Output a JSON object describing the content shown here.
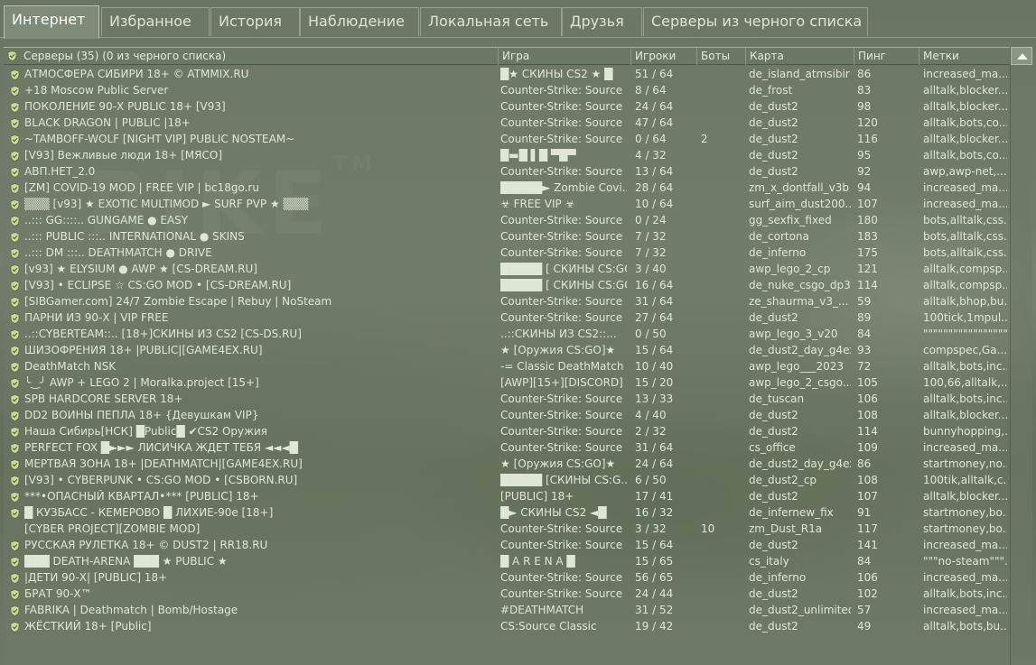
{
  "tabs": [
    {
      "label": "Интернет",
      "active": true
    },
    {
      "label": "Избранное"
    },
    {
      "label": "История"
    },
    {
      "label": "Наблюдение"
    },
    {
      "label": "Локальная сеть"
    },
    {
      "label": "Друзья"
    },
    {
      "label": "Серверы из черного списка"
    }
  ],
  "columns": {
    "servers": "Серверы (35) (0 из черного списка)",
    "game": "Игра",
    "players": "Игроки",
    "bots": "Боты",
    "map": "Карта",
    "ping": "Пинг",
    "tags": "Метки"
  },
  "servers": [
    {
      "name": "АТМОСФЕРА СИБИРИ 18+ © ATMMIX.RU",
      "game": "█★ СКИНЫ CS2 ★ █",
      "players": "51 / 64",
      "bots": "",
      "map": "de_island_atmsibir",
      "ping": "86",
      "tags": "increased_ma..."
    },
    {
      "name": "+18 Moscow Public Server",
      "game": "Counter-Strike: Source",
      "players": "8 / 64",
      "bots": "",
      "map": "de_frost",
      "ping": "83",
      "tags": "alltalk,blocker..."
    },
    {
      "name": "ПОКОЛЕНИЕ 90-Х PUBLIC 18+ [V93]",
      "game": "Counter-Strike: Source",
      "players": "24 / 64",
      "bots": "",
      "map": "de_dust2",
      "ping": "98",
      "tags": "alltalk,blocker..."
    },
    {
      "name": "BLACK DRAGON | PUBLIC |18+",
      "game": "Counter-Strike: Source",
      "players": "47 / 64",
      "bots": "",
      "map": "de_dust2",
      "ping": "120",
      "tags": "alltalk,bots,co..."
    },
    {
      "name": "~TAMBOFF-WOLF [NIGHT VIP] PUBLIC NOSTEAM~",
      "game": "Counter-Strike: Source",
      "players": "0 / 64",
      "bots": "2",
      "map": "de_dust2",
      "ping": "116",
      "tags": "alltalk,blocker..."
    },
    {
      "name": "[V93] Вежливые люди 18+ [МЯСО]",
      "game": "█▬█ ▌█ ▀█▀",
      "players": "4 / 32",
      "bots": "",
      "map": "de_dust2",
      "ping": "95",
      "tags": "alltalk,bots,co..."
    },
    {
      "name": "АВП.НЕТ_2.0",
      "game": "Counter-Strike: Source",
      "players": "13 / 64",
      "bots": "",
      "map": "de_dust2",
      "ping": "92",
      "tags": "awp,awp-net,..."
    },
    {
      "name": "[ZM] COVID-19 MOD | FREE VIP | bc18go.ru",
      "game": "█████► Zombie Covi...",
      "players": "28 / 64",
      "bots": "",
      "map": "zm_x_dontfall_v3b",
      "ping": "94",
      "tags": "increased_ma..."
    },
    {
      "name": "▒▒▒ [v93] ★ EXOTIC MULTIMOD ► SURF PVP ★ ▒▒▒",
      "game": "☣ FREE VIP ☣",
      "players": "10 / 64",
      "bots": "",
      "map": "surf_aim_dust200...",
      "ping": "107",
      "tags": "increased_ma..."
    },
    {
      "name": "..::: GG::::.. GUNGAME ● EASY",
      "game": "Counter-Strike: Source",
      "players": "0 / 24",
      "bots": "",
      "map": "gg_sexfix_fixed",
      "ping": "180",
      "tags": "bots,alltalk,css..."
    },
    {
      "name": "..::: PUBLIC :::.. INTERNATIONAL ● SKINS",
      "game": "Counter-Strike: Source",
      "players": "7 / 32",
      "bots": "",
      "map": "de_cortona",
      "ping": "183",
      "tags": "bots,alltalk,css..."
    },
    {
      "name": "..::: DM :::.. DEATHMATCH ● DRIVE",
      "game": "Counter-Strike: Source",
      "players": "7 / 32",
      "bots": "",
      "map": "de_inferno",
      "ping": "175",
      "tags": "bots,alltalk,css..."
    },
    {
      "name": "[v93] ★ ELYSIUM ● AWP ★ [CS-DREAM.RU]",
      "game": "█████ [ СКИНЫ CS:GO...",
      "players": "3 / 40",
      "bots": "",
      "map": "awp_lego_2_cp",
      "ping": "121",
      "tags": "alltalk,compsp..."
    },
    {
      "name": "[V93] • ECLIPSE ☆ CS:GO MOD • [CS-DREAM.RU]",
      "game": "█████ [ СКИНЫ CS:GO...",
      "players": "16 / 64",
      "bots": "",
      "map": "de_nuke_csgo_dp3",
      "ping": "114",
      "tags": "alltalk,compsp..."
    },
    {
      "name": "[SIBGamer.com] 24/7 Zombie Escape | Rebuy | NoSteam",
      "game": "Counter-Strike: Source",
      "players": "31 / 64",
      "bots": "",
      "map": "ze_shaurma_v3_...",
      "ping": "59",
      "tags": "alltalk,bhop,bu..."
    },
    {
      "name": "ПАРНИ ИЗ 90-Х | VIP FREE",
      "game": "Counter-Strike: Source",
      "players": "27 / 64",
      "bots": "",
      "map": "de_dust2",
      "ping": "89",
      "tags": "100tick,1mpul..."
    },
    {
      "name": "..::CYBERTEAM::.. [18+]СКИНЫ ИЗ CS2 [CS-DS.RU]",
      "game": "..::СКИНЫ ИЗ CS2::...",
      "players": "0 / 50",
      "bots": "",
      "map": "awp_lego_3_v20",
      "ping": "84",
      "tags": "\"\"\"\"\"\"\"\"\"\"\"\"\"\"\"\"\"\"\"..."
    },
    {
      "name": "ШИЗОФРЕНИЯ 18+ |PUBLIC|[GAME4EX.RU]",
      "game": "★ [Оружия CS:GO]★",
      "players": "15 / 64",
      "bots": "",
      "map": "de_dust2_day_g4ex",
      "ping": "93",
      "tags": "compspec,Ga..."
    },
    {
      "name": "DeathMatch NSK",
      "game": "-= Classic DeathMatch ...",
      "players": "10 / 40",
      "bots": "",
      "map": "awp_lego___2023",
      "ping": "72",
      "tags": "alltalk,bots,inc..."
    },
    {
      "name": "╰‿╯ AWP + LEGO 2 | Moralka.project [15+]",
      "game": "[AWP][15+][DISCORD]",
      "players": "15 / 20",
      "bots": "",
      "map": "awp_lego_2_csgo...",
      "ping": "105",
      "tags": "100,66,alltalk,..."
    },
    {
      "name": "SPB HARDCORE SERVER 18+",
      "game": "Counter-Strike: Source",
      "players": "13 / 33",
      "bots": "",
      "map": "de_tuscan",
      "ping": "106",
      "tags": "alltalk,bots,inc..."
    },
    {
      "name": "DD2 ВОИНЫ ПЕПЛА 18+ {Девушкам VIP}",
      "game": "Counter-Strike: Source",
      "players": "4 / 40",
      "bots": "",
      "map": "de_dust2",
      "ping": "108",
      "tags": "alltalk,blocker..."
    },
    {
      "name": "Наша Сибирь[НСК] █Public█ ✔CS2 Оружия",
      "game": "Counter-Strike: Source",
      "players": "2 / 32",
      "bots": "",
      "map": "de_dust2",
      "ping": "114",
      "tags": "bunnyhopping,..."
    },
    {
      "name": "PERFECT FOX █►►► ЛИСИЧКА ЖДЕТ ТЕБЯ ◄◄◄█",
      "game": "Counter-Strike: Source",
      "players": "31 / 64",
      "bots": "",
      "map": "cs_office",
      "ping": "109",
      "tags": "increased_ma..."
    },
    {
      "name": "МЕРТВАЯ ЗОНА 18+ |DEATHMATCH|[GAME4EX.RU]",
      "game": "★ [Оружия CS:GO]★",
      "players": "24 / 64",
      "bots": "",
      "map": "de_dust2_day_g4ex",
      "ping": "86",
      "tags": "startmoney,no..."
    },
    {
      "name": "[V93] • CYBERPUNK • CS:GO MOD • [CSBORN.RU]",
      "game": "█████ [СКИНЫ CS:G...",
      "players": "6 / 50",
      "bots": "",
      "map": "de_dust2_cp",
      "ping": "108",
      "tags": "100tik,alltalk,c..."
    },
    {
      "name": "***•ОПАСНЫЙ КВАРТАЛ•*** [PUBLIC] 18+",
      "game": "[PUBLIC] 18+",
      "players": "17 / 41",
      "bots": "",
      "map": "de_dust2",
      "ping": "107",
      "tags": "alltalk,blocker..."
    },
    {
      "name": "█ КУЗБАСС - КЕМЕРОВО █ ЛИХИЕ-90е [18+]",
      "game": "█► СКИНЫ CS2 ◄█",
      "players": "16 / 32",
      "bots": "",
      "map": "de_infernew_fix",
      "ping": "91",
      "tags": "startmoney,bo..."
    },
    {
      "name": "[CYBER PROJECT][ZOMBIE MOD]",
      "game": "Counter-Strike: Source",
      "players": "3 / 32",
      "bots": "10",
      "map": "zm_Dust_R1a",
      "ping": "117",
      "tags": "startmoney,bo...",
      "no_icon": true
    },
    {
      "name": "РУССКАЯ РУЛЕТКА 18+ © DUST2 | RR18.RU",
      "game": "Counter-Strike: Source",
      "players": "15 / 64",
      "bots": "",
      "map": "de_dust2",
      "ping": "141",
      "tags": "increased_ma..."
    },
    {
      "name": "███ DEATH-ARENA ███ ★ PUBLIC ★",
      "game": "█ A R E N A █",
      "players": "15 / 65",
      "bots": "",
      "map": "cs_italy",
      "ping": "84",
      "tags": "\"\"\"no-steam\"\"\"."
    },
    {
      "name": "|ДЕТИ 90-Х| [PUBLIC] 18+",
      "game": "Counter-Strike: Source",
      "players": "56 / 65",
      "bots": "",
      "map": "de_inferno",
      "ping": "106",
      "tags": "increased_ma..."
    },
    {
      "name": "БРАТ 90-Х™",
      "game": "Counter-Strike: Source",
      "players": "24 / 44",
      "bots": "",
      "map": "de_dust2",
      "ping": "102",
      "tags": "alltalk,bots,inc..."
    },
    {
      "name": "FABRIKA | Deathmatch | Bomb/Hostage",
      "game": "#DEATHMATCH",
      "players": "31 / 52",
      "bots": "",
      "map": "de_dust2_unlimited",
      "ping": "57",
      "tags": "increased_ma..."
    },
    {
      "name": "ЖЁСТКИЙ 18+ [Public]",
      "game": "CS:Source Classic",
      "players": "19 / 42",
      "bots": "",
      "map": "de_dust2",
      "ping": "49",
      "tags": "alltalk,bots,bu..."
    }
  ]
}
